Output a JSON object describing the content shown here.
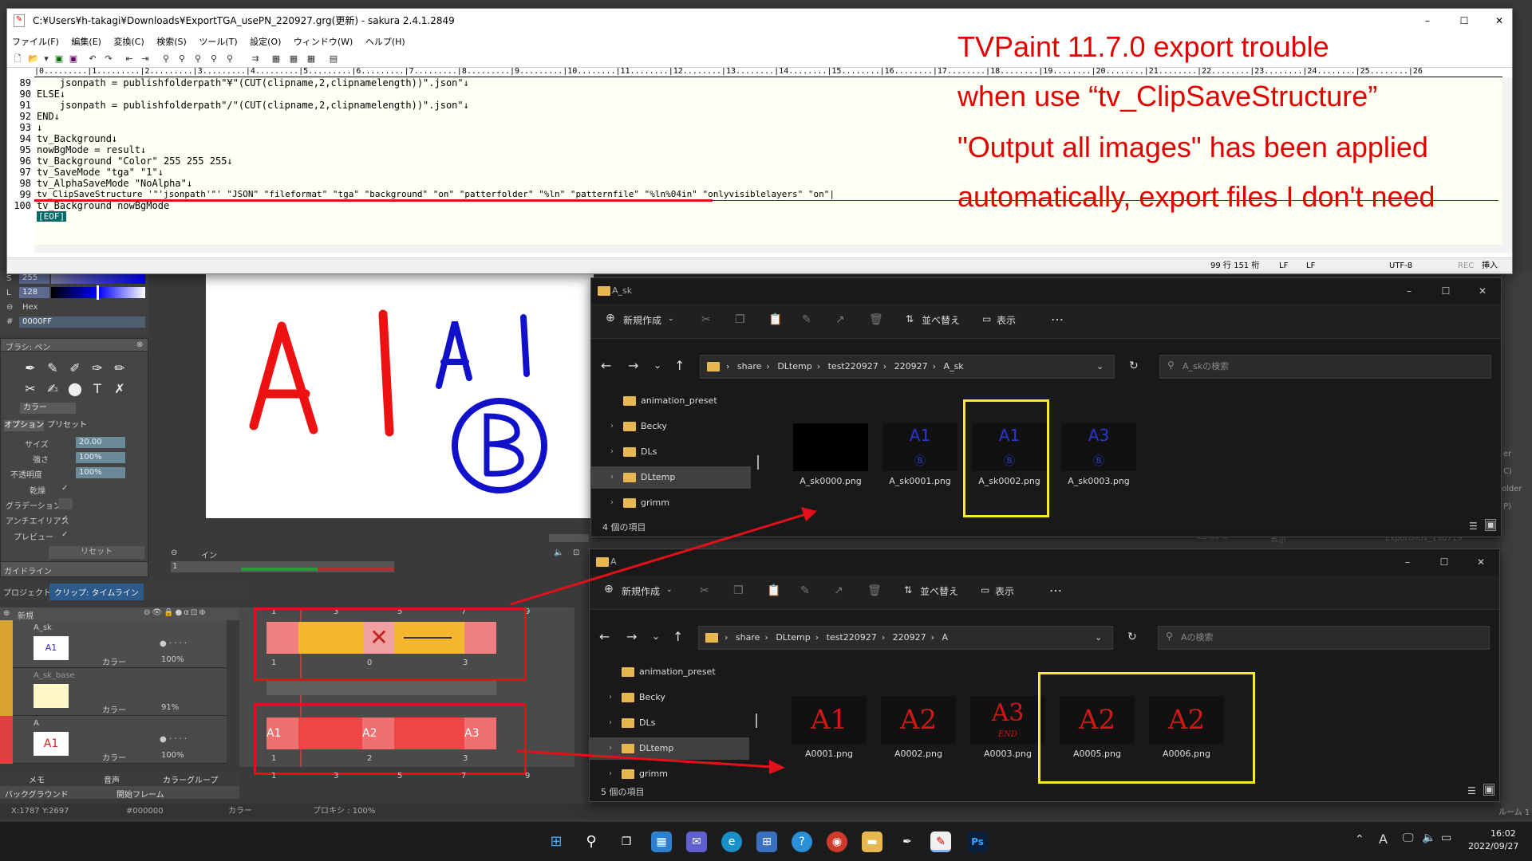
{
  "sakura": {
    "title": "C:¥Users¥h-takagi¥Downloads¥ExportTGA_usePN_220927.grg(更新) - sakura 2.4.1.2849",
    "menu": [
      "ファイル(F)",
      "編集(E)",
      "変換(C)",
      "検索(S)",
      "ツール(T)",
      "設定(O)",
      "ウィンドウ(W)",
      "ヘルプ(H)"
    ],
    "ruler": "|0.........|1.........|2.........|3.........|4.........|5.........|6.........|7.........|8.........|9.........|10........|11........|12........|13........|14........|15........|16........|17........|18........|19........|20........|21........|22........|23........|24........|25........|26",
    "lines": [
      {
        "n": "89",
        "t": "    jsonpath = publishfolderpath\"¥\"(CUT(clipname,2,clipnamelength))\".json\"↓"
      },
      {
        "n": "90",
        "t": "ELSE↓"
      },
      {
        "n": "91",
        "t": "    jsonpath = publishfolderpath\"/\"(CUT(clipname,2,clipnamelength))\".json\"↓"
      },
      {
        "n": "92",
        "t": "END↓"
      },
      {
        "n": "93",
        "t": "↓"
      },
      {
        "n": "94",
        "t": "tv_Background↓"
      },
      {
        "n": "95",
        "t": "nowBgMode = result↓"
      },
      {
        "n": "96",
        "t": "tv_Background \"Color\" 255 255 255↓"
      },
      {
        "n": "97",
        "t": "tv_SaveMode \"tga\" \"1\"↓"
      },
      {
        "n": "98",
        "t": "tv_AlphaSaveMode \"NoAlpha\"↓"
      },
      {
        "n": "99",
        "t": "tv_ClipSaveStructure '\"'jsonpath'\"' \"JSON\" \"fileformat\" \"tga\" \"background\" \"on\" \"patterfolder\" \"%ln\" \"patternfile\" \"%ln%04in\" \"onlyvisiblelayers\" \"on\"|"
      },
      {
        "n": "100",
        "t": "tv_Background nowBgMode"
      }
    ],
    "eof": "[EOF]",
    "status": {
      "pos": "99 行 151 桁",
      "eol1": "LF",
      "eol2": "LF",
      "enc": "UTF-8",
      "rec": "REC",
      "ins": "挿入"
    }
  },
  "annotation": [
    "TVPaint 11.7.0 export trouble",
    "when use “tv_ClipSaveStructure”",
    "\"Output all images\" has been applied",
    "automatically, export files I don't need"
  ],
  "tvpaint": {
    "color": {
      "s_label": "S",
      "s_val": "255",
      "l_label": "L",
      "l_val": "128",
      "hex_label": "Hex",
      "hash": "#",
      "hex_val": "0000FF"
    },
    "brush_panel": "ブラシ: ペン",
    "color_mode": "カラー",
    "option_tabs": [
      "オプション",
      "プリセット"
    ],
    "props": [
      {
        "label": "サイズ",
        "value": "20.00"
      },
      {
        "label": "強さ",
        "value": "100%"
      },
      {
        "label": "不透明度",
        "value": "100%"
      }
    ],
    "toggles": [
      "乾燥",
      "グラデーション",
      "アンチエイリアス",
      "プレビュー"
    ],
    "reset": "リセット",
    "guide": "ガイドライン",
    "in_label": "イン",
    "frame_one": "1",
    "tabs": [
      "プロジェクト",
      "クリップ: タイムライン"
    ],
    "new_layer": "新規",
    "layers": [
      {
        "name": "A_sk",
        "mode": "カラー",
        "opacity": "100%",
        "thumb": "A1"
      },
      {
        "name": "A_sk_base",
        "mode": "カラー",
        "opacity": "91%",
        "thumb": ""
      },
      {
        "name": "A",
        "mode": "カラー",
        "opacity": "100%",
        "thumb": "A1"
      }
    ],
    "timeline_ruler": [
      "1",
      "3",
      "5",
      "7",
      "9"
    ],
    "row1_labels": [
      "1",
      "0",
      "3"
    ],
    "row2_labels": [
      "1",
      "2",
      "3"
    ],
    "bottom_tabs": [
      "メモ",
      "音声",
      "カラーグループ"
    ],
    "bg_row": [
      "バックグラウンド",
      "開始フレーム"
    ],
    "statusbar": {
      "coords": "X:1787  Y:2697",
      "color": "#000000",
      "mode": "カラー",
      "proxy": "プロキシ : 100%"
    },
    "right_strip": [
      "er",
      "C)",
      "older",
      "P)",
      "25.00%",
      "表示",
      "ExportMov_190719",
      "ルーム 1"
    ]
  },
  "canvas_letters": {
    "left": "A l",
    "right": "A l",
    "circle": "B"
  },
  "explorer1": {
    "title": "A_sk",
    "new": "新規作成",
    "sort": "並べ替え",
    "view": "表示",
    "path": [
      "share",
      "DLtemp",
      "test220927",
      "220927",
      "A_sk"
    ],
    "search": "A_skの検索",
    "tree": [
      "animation_preset",
      "Becky",
      "DLs",
      "DLtemp",
      "grimm"
    ],
    "files": [
      "A_sk0000.png",
      "A_sk0001.png",
      "A_sk0002.png",
      "A_sk0003.png"
    ],
    "count": "4 個の項目"
  },
  "explorer2": {
    "title": "A",
    "new": "新規作成",
    "sort": "並べ替え",
    "view": "表示",
    "path": [
      "share",
      "DLtemp",
      "test220927",
      "220927",
      "A"
    ],
    "search": "Aの検索",
    "tree": [
      "animation_preset",
      "Becky",
      "DLs",
      "DLtemp",
      "grimm"
    ],
    "files": [
      {
        "name": "A0001.png",
        "thumb": "A1"
      },
      {
        "name": "A0002.png",
        "thumb": "A2"
      },
      {
        "name": "A0003.png",
        "thumb": "A3"
      },
      {
        "name": "A0005.png",
        "thumb": "A2"
      },
      {
        "name": "A0006.png",
        "thumb": "A2"
      }
    ],
    "end_mark": "END",
    "count": "5 個の項目"
  },
  "taskbar": {
    "time": "16:02",
    "date": "2022/09/27",
    "ime": "A",
    "ps": "Ps"
  },
  "colors": {
    "annotation": "#e00000",
    "highlight": "#f7ea25",
    "redbox": "#e3101a",
    "folder": "#e6b84f"
  }
}
